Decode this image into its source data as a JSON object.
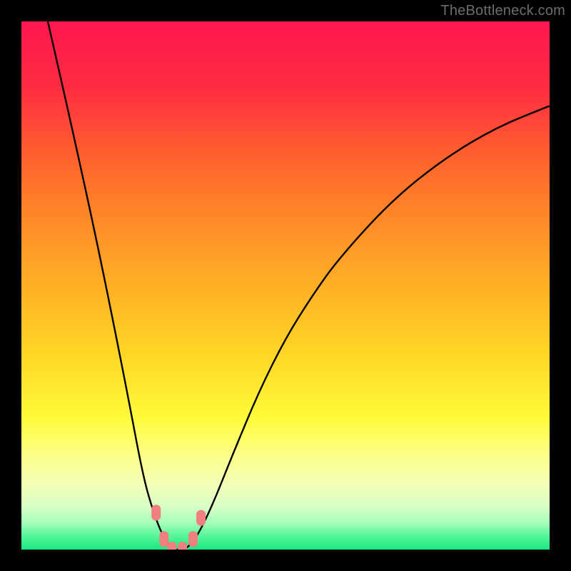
{
  "watermark": {
    "text": "TheBottleneck.com"
  },
  "colors": {
    "frame_bg": "#000000",
    "curve": "#000000",
    "marker": "#f08080",
    "gradient_stops": [
      {
        "pct": 0,
        "color": "#ff1750"
      },
      {
        "pct": 12,
        "color": "#ff2b41"
      },
      {
        "pct": 28,
        "color": "#ff6a2b"
      },
      {
        "pct": 45,
        "color": "#ffa126"
      },
      {
        "pct": 62,
        "color": "#ffd324"
      },
      {
        "pct": 75,
        "color": "#fffb3a"
      },
      {
        "pct": 82,
        "color": "#fdff87"
      },
      {
        "pct": 88,
        "color": "#f2ffb9"
      },
      {
        "pct": 92,
        "color": "#d7ffc6"
      },
      {
        "pct": 95,
        "color": "#a4ffba"
      },
      {
        "pct": 97,
        "color": "#62f79f"
      },
      {
        "pct": 100,
        "color": "#17e880"
      }
    ]
  },
  "chart_data": {
    "type": "line",
    "title": "",
    "xlabel": "",
    "ylabel": "",
    "xlim": [
      0,
      100
    ],
    "ylim": [
      0,
      100
    ],
    "series": [
      {
        "name": "bottleneck-curve",
        "x": [
          5,
          10,
          15,
          20,
          23,
          25,
          27,
          29,
          30,
          31,
          33,
          36,
          40,
          45,
          50,
          55,
          60,
          70,
          80,
          90,
          100
        ],
        "y": [
          100,
          78,
          55,
          30,
          14,
          7,
          2,
          0,
          0,
          0,
          2,
          8,
          18,
          30,
          40,
          48,
          55,
          66,
          74,
          80,
          84
        ]
      }
    ],
    "markers": [
      {
        "x": 25.5,
        "y": 7
      },
      {
        "x": 27.0,
        "y": 2
      },
      {
        "x": 28.5,
        "y": 0
      },
      {
        "x": 30.5,
        "y": 0
      },
      {
        "x": 32.5,
        "y": 2
      },
      {
        "x": 34.0,
        "y": 6
      }
    ],
    "annotations": []
  }
}
